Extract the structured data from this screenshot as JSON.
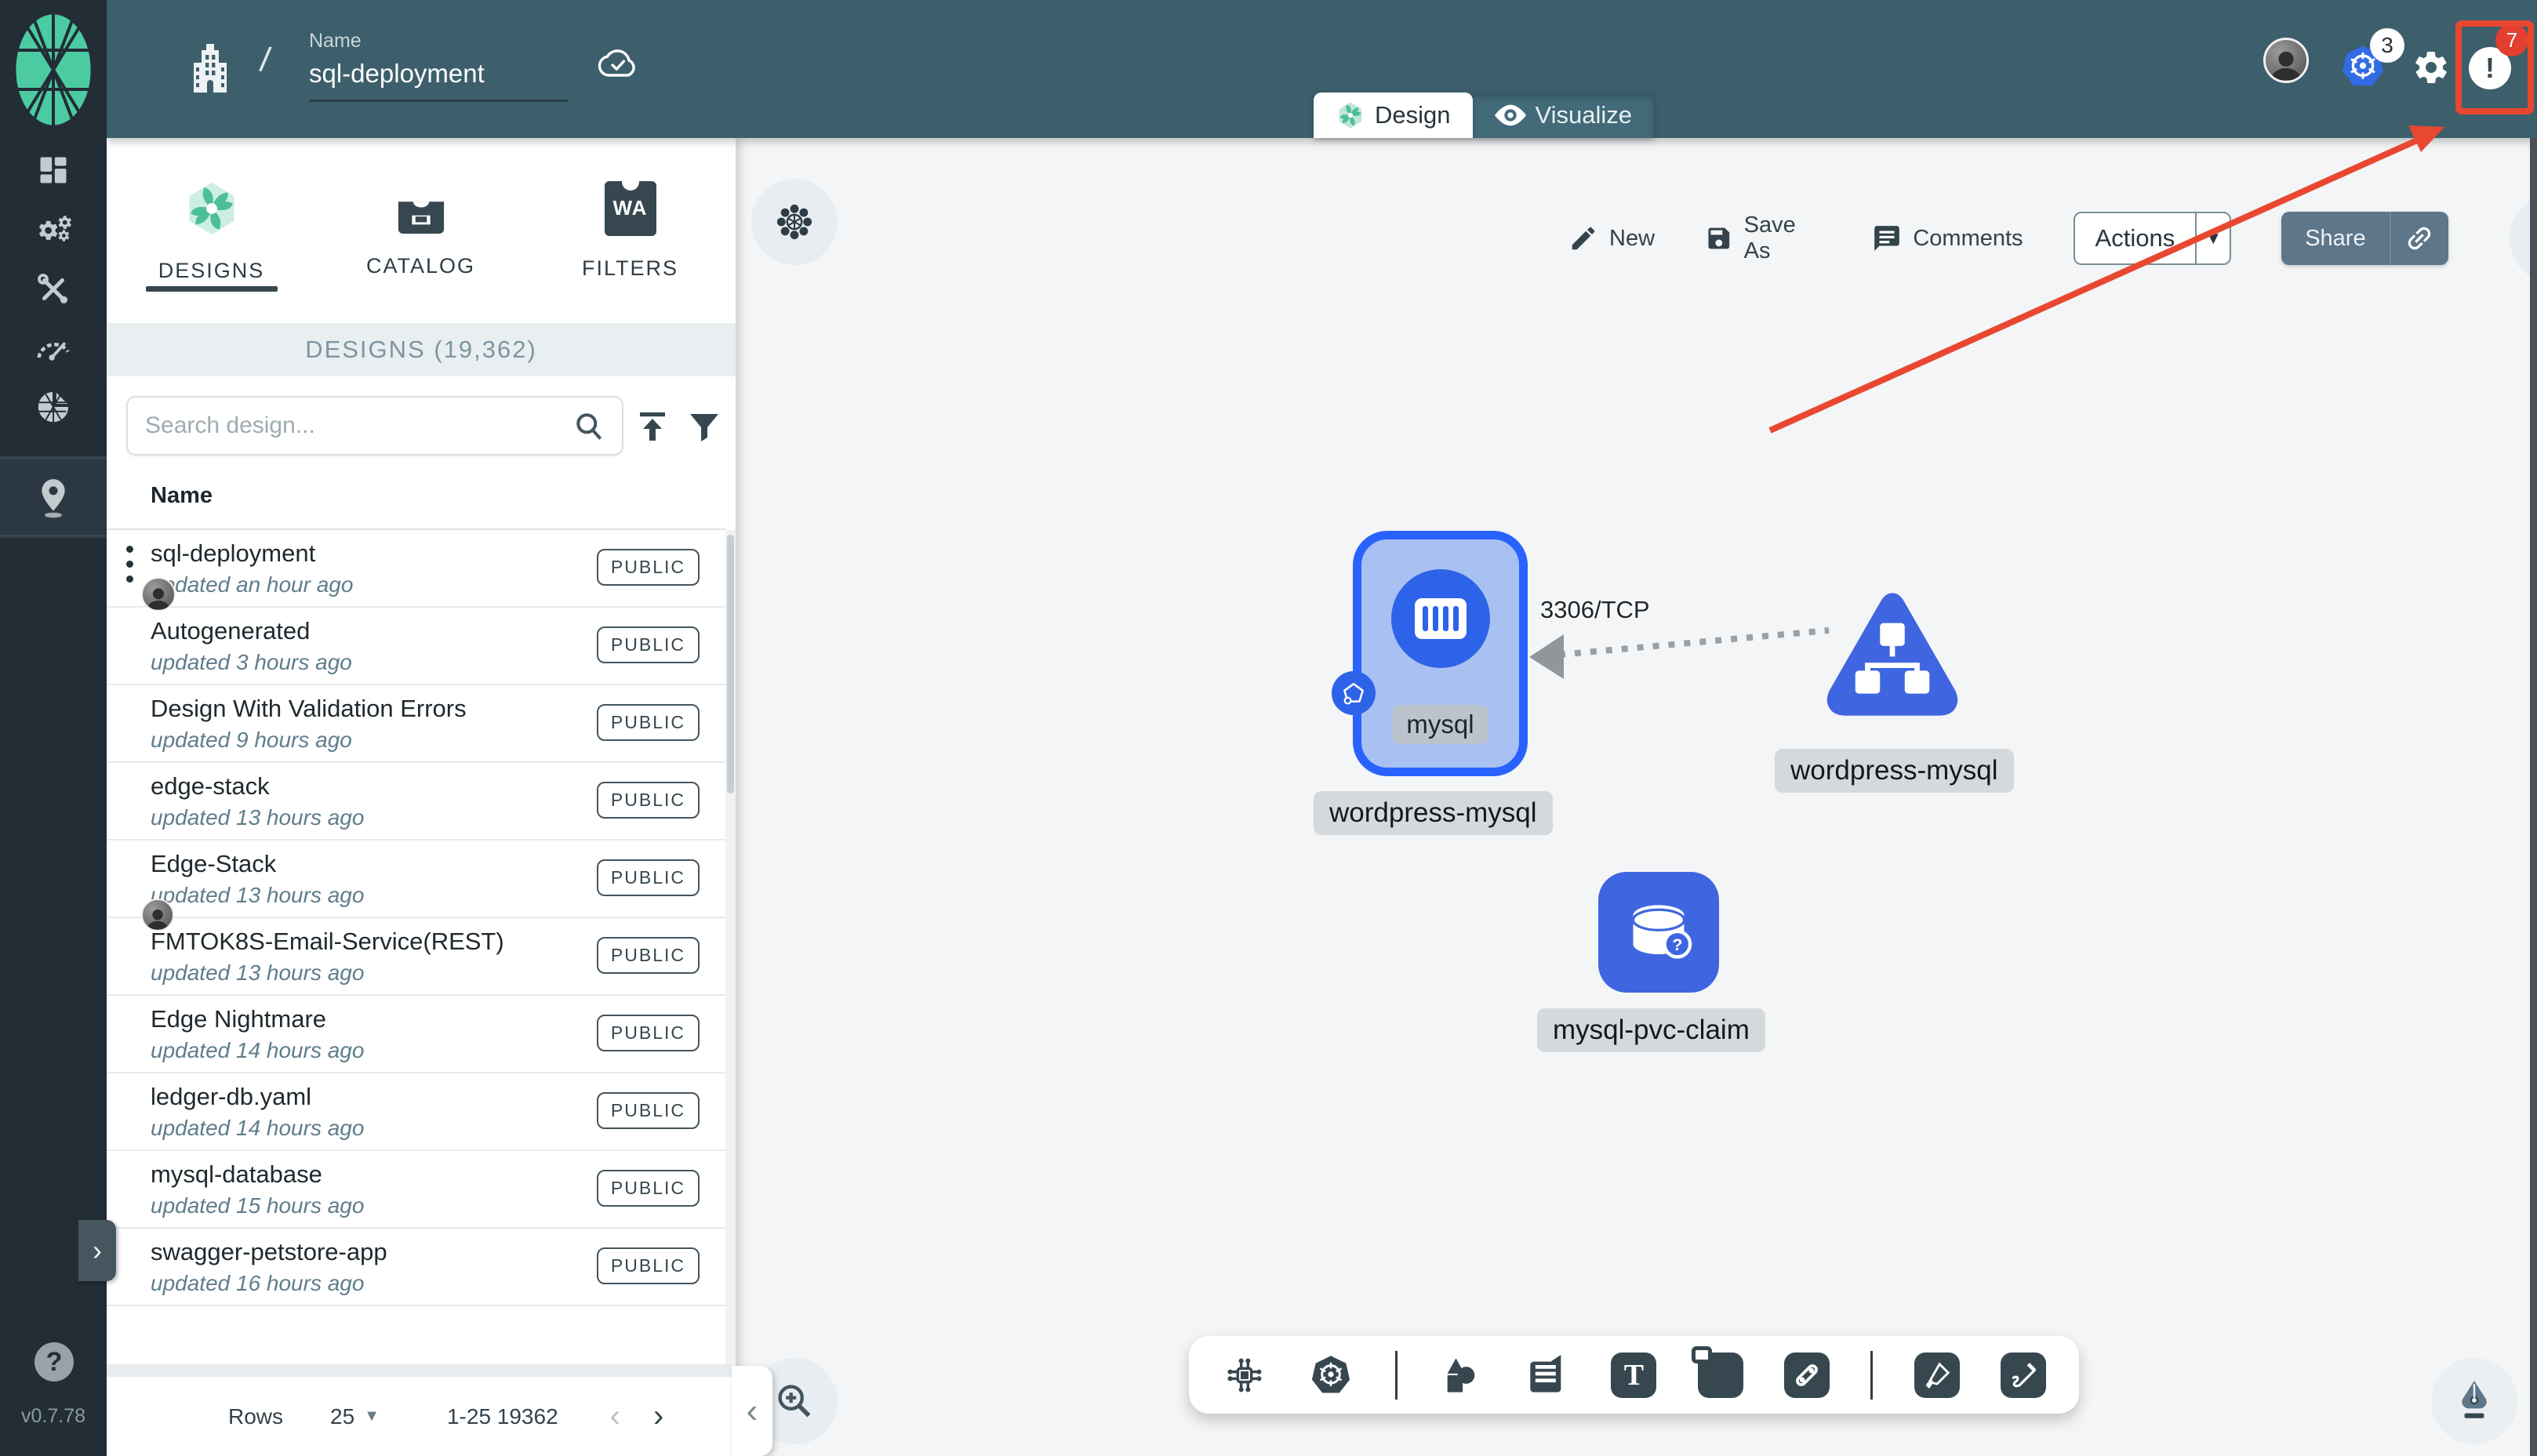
{
  "header": {
    "name_label": "Name",
    "name_value": "sql-deployment",
    "separator": "/",
    "kubernetes_context_count": "3",
    "notification_count": "7",
    "notification_glyph": "!"
  },
  "view_tabs": {
    "design": "Design",
    "visualize": "Visualize"
  },
  "sidebar": {
    "items": [
      "dashboard",
      "lifecycle",
      "configuration",
      "performance",
      "extensions",
      "location"
    ],
    "help": "?",
    "version": "v0.7.78",
    "expand_glyph": "›"
  },
  "panel": {
    "tabs": [
      {
        "label": "DESIGNS"
      },
      {
        "label": "CATALOG"
      },
      {
        "label": "FILTERS"
      }
    ],
    "filters_badge": "WA",
    "section_title": "DESIGNS (19,362)",
    "search_placeholder": "Search design...",
    "column_header": "Name",
    "designs": [
      {
        "name": "sql-deployment",
        "updated": "updated an hour ago",
        "visibility": "PUBLIC"
      },
      {
        "name": "Autogenerated",
        "updated": "updated 3 hours ago",
        "visibility": "PUBLIC"
      },
      {
        "name": "Design With Validation Errors",
        "updated": "updated 9 hours ago",
        "visibility": "PUBLIC"
      },
      {
        "name": "edge-stack",
        "updated": "updated 13 hours ago",
        "visibility": "PUBLIC"
      },
      {
        "name": "Edge-Stack",
        "updated": "updated 13 hours ago",
        "visibility": "PUBLIC"
      },
      {
        "name": "FMTOK8S-Email-Service(REST)",
        "updated": "updated 13 hours ago",
        "visibility": "PUBLIC"
      },
      {
        "name": "Edge Nightmare",
        "updated": "updated 14 hours ago",
        "visibility": "PUBLIC"
      },
      {
        "name": "ledger-db.yaml",
        "updated": "updated 14 hours ago",
        "visibility": "PUBLIC"
      },
      {
        "name": "mysql-database",
        "updated": "updated 15 hours ago",
        "visibility": "PUBLIC"
      },
      {
        "name": "swagger-petstore-app",
        "updated": "updated 16 hours ago",
        "visibility": "PUBLIC"
      }
    ],
    "pagination": {
      "rows_label": "Rows",
      "rows_per_page": "25",
      "range": "1-25 19362",
      "prev_glyph": "‹",
      "next_glyph": "›"
    },
    "collapse_glyph": "‹"
  },
  "canvas": {
    "actions": {
      "new": "New",
      "save_as": "Save As",
      "comments": "Comments",
      "actions": "Actions",
      "share": "Share",
      "dropdown_glyph": "▼"
    },
    "nodes": {
      "pod": {
        "chip": "mysql",
        "label": "wordpress-mysql"
      },
      "service": {
        "label": "wordpress-mysql"
      },
      "pvc": {
        "label": "mysql-pvc-claim",
        "badge": "?"
      }
    },
    "edge": {
      "label": "3306/TCP"
    }
  },
  "colors": {
    "header_teal": "#3d5f6c",
    "sidebar_dark": "#222d36",
    "accent_green": "#5cc9a5",
    "node_blue_border": "#2962ff",
    "node_blue_fill": "#a9c1f2",
    "node_blue_solid": "#3f66e0",
    "kubernetes_blue": "#326ce5",
    "slate": "#37474f",
    "annotation_red": "#e84730",
    "badge_red": "#e23f30"
  }
}
